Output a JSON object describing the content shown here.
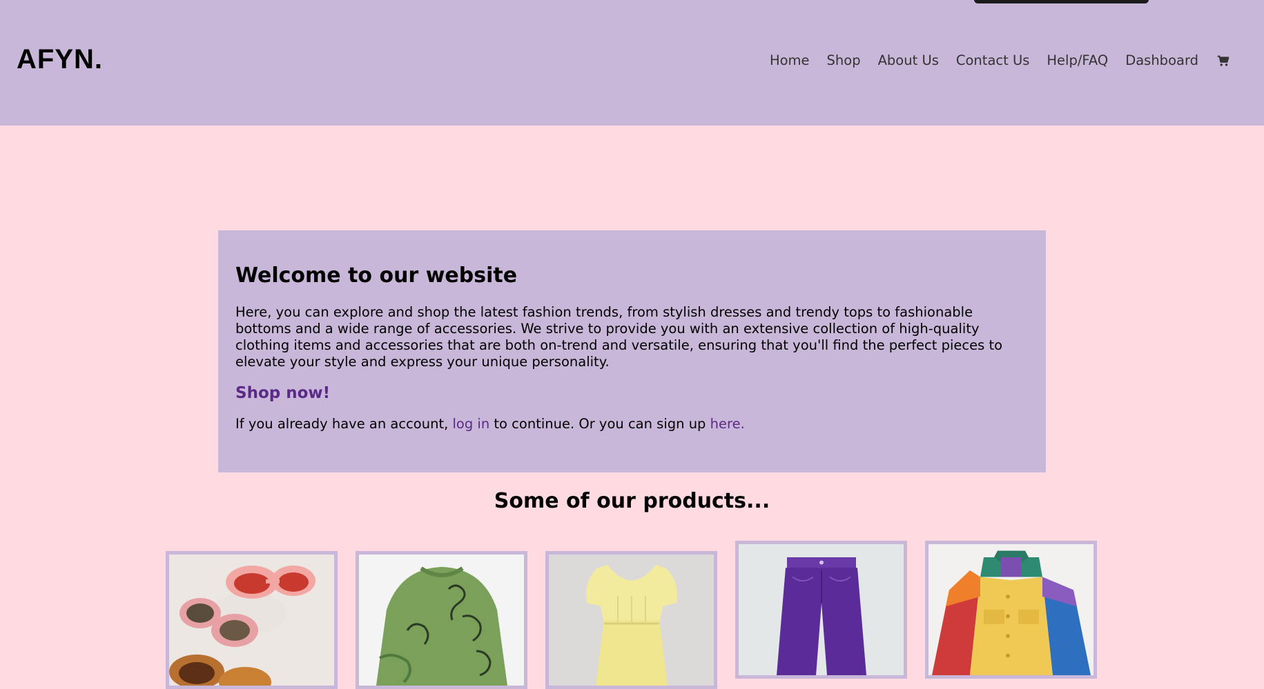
{
  "header": {
    "logo": "AFYN.",
    "nav": [
      {
        "label": "Home"
      },
      {
        "label": "Shop"
      },
      {
        "label": "About Us"
      },
      {
        "label": "Contact Us"
      },
      {
        "label": "Help/FAQ"
      },
      {
        "label": "Dashboard"
      }
    ],
    "cart_icon": "shopping-cart-icon"
  },
  "welcome": {
    "title": "Welcome to our website",
    "intro": "Here, you can explore and shop the latest fashion trends, from stylish dresses and trendy tops to fashionable bottoms and a wide range of accessories. We strive to provide you with an extensive collection of high-quality clothing items and accessories that are both on-trend and versatile, ensuring that you'll find the perfect pieces to elevate your style and express your unique personality.",
    "shop_now": "Shop now!",
    "account_prefix": "If you already have an account,",
    "login_link": "log in",
    "account_middle": "to continue. Or you can sign up",
    "signup_link": "here."
  },
  "products": {
    "heading": "Some of our products...",
    "items": [
      {
        "name": "sunglasses"
      },
      {
        "name": "sweater"
      },
      {
        "name": "dress"
      },
      {
        "name": "jeans"
      },
      {
        "name": "jacket"
      }
    ]
  },
  "colors": {
    "header_bg": "#c9b7d9",
    "page_bg": "#ffdbe1",
    "accent_link": "#5b2a86"
  }
}
